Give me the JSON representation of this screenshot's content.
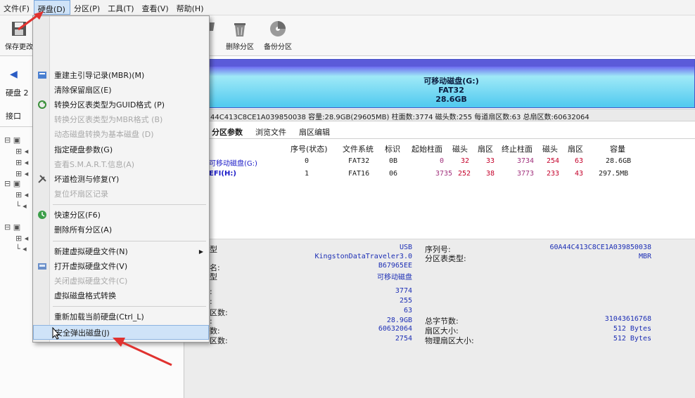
{
  "menubar": {
    "items": [
      "文件(F)",
      "硬盘(D)",
      "分区(P)",
      "工具(T)",
      "查看(V)",
      "帮助(H)"
    ]
  },
  "toolbar": {
    "save_label": "保存更改",
    "delete_partition_label": "删除分区",
    "backup_partition_label": "备份分区"
  },
  "left_panel": {
    "disk_label": "硬盘 2",
    "interface_label": "接口"
  },
  "banner": {
    "line1": "可移动磁盘(G:)",
    "line2": "FAT32",
    "line3": "28.6GB"
  },
  "info_strip": {
    "text": "44C413C8CE1A039850038  容量:28.9GB(29605MB)  柱面数:3774  磁头数:255  每道扇区数:63  总扇区数:60632064"
  },
  "tabs": [
    "分区参数",
    "浏览文件",
    "扇区编辑"
  ],
  "partition_table": {
    "headers": [
      "序号(状态)",
      "文件系统",
      "标识",
      "起始柱面",
      "磁头",
      "扇区",
      "终止柱面",
      "磁头",
      "扇区",
      "容量"
    ],
    "rows": [
      {
        "name": "可移动磁盘(G:)",
        "index": "0",
        "fs": "FAT32",
        "id": "0B",
        "start_cyl": "0",
        "start_head": "32",
        "start_sec": "33",
        "end_cyl": "3734",
        "end_head": "254",
        "end_sec": "63",
        "size": "28.6GB"
      },
      {
        "name": "EFI(H:)",
        "index": "1",
        "fs": "FAT16",
        "id": "06",
        "start_cyl": "3735",
        "start_head": "252",
        "start_sec": "38",
        "end_cyl": "3773",
        "end_head": "233",
        "end_sec": "43",
        "size": "297.5MB"
      }
    ]
  },
  "details": {
    "left_labels": [
      "型",
      "名:",
      "型",
      ":",
      ":",
      "区数:",
      ":",
      "数:",
      "区数:"
    ],
    "left_values": [
      "USB",
      "KingstonDataTraveler3.0",
      "B67965EE",
      "可移动磁盘",
      "3774",
      "255",
      "63",
      "28.9GB",
      "60632064",
      "2754"
    ],
    "right_labels": [
      "序列号:",
      "分区表类型:",
      "总字节数:",
      "扇区大小:",
      "物理扇区大小:"
    ],
    "right_values": [
      "60A44C413C8CE1A039850038",
      "MBR",
      "31043616768",
      "512 Bytes",
      "512 Bytes"
    ]
  },
  "dropdown": {
    "items": [
      {
        "label": "重建主引导记录(MBR)(M)",
        "disabled": false
      },
      {
        "label": "清除保留扇区(E)",
        "disabled": false
      },
      {
        "label": "转换分区表类型为GUID格式 (P)",
        "disabled": false
      },
      {
        "label": "转换分区表类型为MBR格式 (B)",
        "disabled": true
      },
      {
        "label": "动态磁盘转换为基本磁盘 (D)",
        "disabled": true
      },
      {
        "label": "指定硬盘参数(G)",
        "disabled": false
      },
      {
        "label": "查看S.M.A.R.T.信息(A)",
        "disabled": true
      },
      {
        "label": "坏道检测与修复(Y)",
        "disabled": false
      },
      {
        "label": "复位坏扇区记录",
        "disabled": true
      },
      {
        "label": "快速分区(F6)",
        "disabled": false
      },
      {
        "label": "删除所有分区(A)",
        "disabled": false
      },
      {
        "label": "新建虚拟硬盘文件(N)",
        "disabled": false
      },
      {
        "label": "打开虚拟硬盘文件(V)",
        "disabled": false
      },
      {
        "label": "关闭虚拟硬盘文件(C)",
        "disabled": true
      },
      {
        "label": "虚拟磁盘格式转换",
        "disabled": false
      },
      {
        "label": "重新加载当前硬盘(Ctrl_L)",
        "disabled": false
      },
      {
        "label": "安全弹出磁盘(J)",
        "disabled": false
      }
    ]
  },
  "colors": {
    "accent_arrow": "#e0322f",
    "menu_highlight": "#cfe3f8",
    "banner_top": "#5b5bd9",
    "banner_bottom": "#4fc9ef"
  }
}
